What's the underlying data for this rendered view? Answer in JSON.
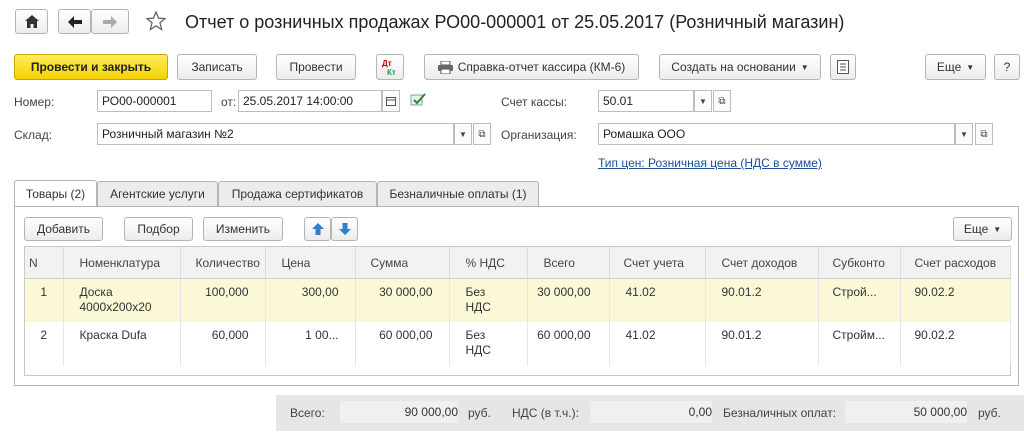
{
  "header": {
    "title": "Отчет о розничных продажах РО00-000001 от 25.05.2017 (Розничный магазин)",
    "home_icon": "home-icon",
    "back_icon": "arrow-left-icon",
    "forward_icon": "arrow-right-icon",
    "favorite_icon": "star-icon"
  },
  "toolbar": {
    "post_close": "Провести и закрыть",
    "save": "Записать",
    "post": "Провести",
    "dtkt_icon": "dt-kt-icon",
    "km6": "Справка-отчет кассира (КМ-6)",
    "create_based": "Создать на основании",
    "more": "Еще",
    "help": "?"
  },
  "form": {
    "number_label": "Номер:",
    "number_value": "РО00-000001",
    "date_label": "от:",
    "date_value": "25.05.2017 14:00:00",
    "cash_account_label": "Счет кассы:",
    "cash_account_value": "50.01",
    "warehouse_label": "Склад:",
    "warehouse_value": "Розничный магазин №2",
    "org_label": "Организация:",
    "org_value": "Ромашка ООО",
    "price_type_link": "Тип цен: Розничная цена (НДС в сумме)"
  },
  "tabs": [
    {
      "label": "Товары (2)",
      "active": true
    },
    {
      "label": "Агентские услуги",
      "active": false
    },
    {
      "label": "Продажа сертификатов",
      "active": false
    },
    {
      "label": "Безналичные оплаты (1)",
      "active": false
    }
  ],
  "table_toolbar": {
    "add": "Добавить",
    "pick": "Подбор",
    "change": "Изменить",
    "more": "Еще"
  },
  "table": {
    "columns": [
      "N",
      "Номенклатура",
      "Количество",
      "Цена",
      "Сумма",
      "% НДС",
      "Всего",
      "Счет учета",
      "Счет доходов",
      "Субконто",
      "Счет расходов"
    ],
    "rows": [
      {
        "n": "1",
        "item_line1": "Доска",
        "item_line2": "4000х200х20",
        "qty": "100,000",
        "price": "300,00",
        "sum": "30 000,00",
        "vat_line1": "Без",
        "vat_line2": "НДС",
        "total": "30 000,00",
        "acc": "41.02",
        "income": "90.01.2",
        "sub": "Строй...",
        "expense": "90.02.2"
      },
      {
        "n": "2",
        "item_line1": "Краска Dufa",
        "item_line2": "",
        "qty": "60,000",
        "price": "1 00...",
        "sum": "60 000,00",
        "vat_line1": "Без",
        "vat_line2": "НДС",
        "total": "60 000,00",
        "acc": "41.02",
        "income": "90.01.2",
        "sub": "Стройм...",
        "expense": "90.02.2"
      }
    ]
  },
  "footer": {
    "total_label": "Всего:",
    "total_value": "90 000,00",
    "currency1": "руб.",
    "vat_label": "НДС (в т.ч.):",
    "vat_value": "0,00",
    "noncash_label": "Безналичных оплат:",
    "noncash_value": "50 000,00",
    "currency2": "руб."
  }
}
